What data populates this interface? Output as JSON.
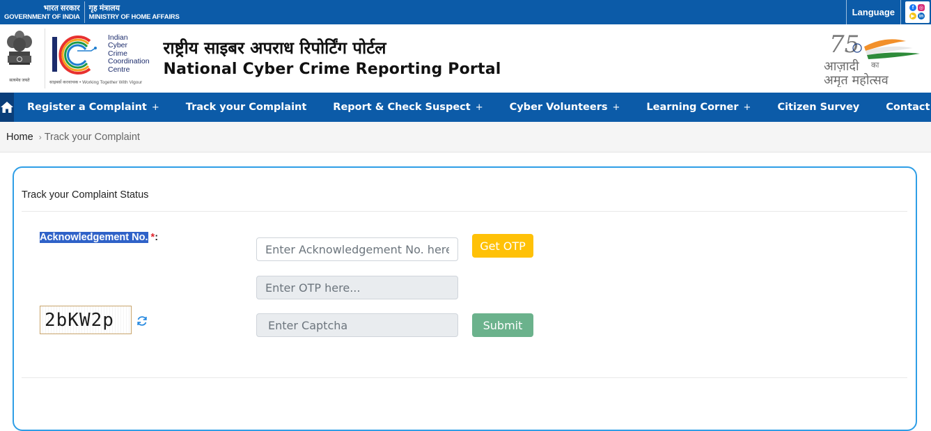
{
  "gov": {
    "hi_left": "भारत सरकार",
    "en_left": "GOVERNMENT OF INDIA",
    "hi_right": "गृह मंत्रालय",
    "en_right": "MINISTRY OF HOME AFFAIRS",
    "language_label": "Language"
  },
  "header": {
    "emblem_motto": "सत्यमेव जयते",
    "i4c_lines": [
      "Indian",
      "Cyber",
      "Crime",
      "Coordination",
      "Centre"
    ],
    "i4c_tagline": "साइबर्स करवाचक  •  Working Together With Vigour",
    "title_hi": "राष्ट्रीय साइबर अपराध रिपोर्टिंग पोर्टल",
    "title_en": "National Cyber Crime Reporting Portal",
    "azadi_line1": "आज़ादी",
    "azadi_ka": "का",
    "azadi_line2": "अमृत महोत्सव"
  },
  "nav": {
    "items": [
      {
        "label": "Register a Complaint",
        "plus": "+"
      },
      {
        "label": "Track your Complaint",
        "plus": ""
      },
      {
        "label": "Report & Check Suspect",
        "plus": "+"
      },
      {
        "label": "Cyber Volunteers",
        "plus": "+"
      },
      {
        "label": "Learning Corner",
        "plus": "+"
      },
      {
        "label": "Citizen Survey",
        "plus": ""
      },
      {
        "label": "Contact Us",
        "plus": ""
      }
    ]
  },
  "breadcrumb": {
    "home": "Home",
    "sep": "›",
    "current": "Track your Complaint"
  },
  "form": {
    "card_title": "Track your Complaint Status",
    "ack_label": "Acknowledgement No.",
    "ack_required": "*",
    "ack_colon": ":",
    "ack_placeholder": "Enter Acknowledgement No. here...",
    "otp_placeholder": "Enter OTP here...",
    "captcha_placeholder": "Enter Captcha",
    "captcha_text": "2bKW2p",
    "get_otp_label": "Get OTP",
    "submit_label": "Submit"
  },
  "colors": {
    "primary_blue": "#0c5ba8",
    "home_dark": "#0a3e7a",
    "card_border": "#2e9ee6",
    "otp_button": "#ffc107",
    "submit_button": "#6bb28c",
    "required_star": "#e0262e"
  },
  "icons": {
    "home": "home-icon",
    "refresh": "refresh-icon",
    "facebook": "facebook-icon",
    "instagram": "instagram-icon",
    "youtube": "youtube-icon",
    "linkedin": "linkedin-icon"
  }
}
